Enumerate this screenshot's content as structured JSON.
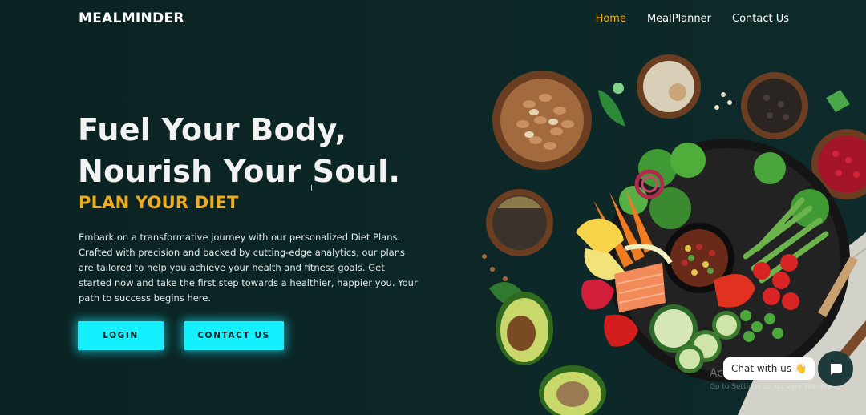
{
  "header": {
    "brand": "MEALMINDER",
    "nav": [
      {
        "label": "Home",
        "active": true
      },
      {
        "label": "MealPlanner",
        "active": false
      },
      {
        "label": "Contact Us",
        "active": false
      }
    ]
  },
  "hero": {
    "title_line1": "Fuel Your Body,",
    "title_line2": "Nourish Your Soul.",
    "subtitle": "PLAN YOUR DIET",
    "description": "Embark on a transformative journey with our personalized Diet Plans. Crafted with precision and backed by cutting-edge analytics, our plans are tailored to help you achieve your health and fitness goals. Get started now and take the first step towards a healthier, happier you. Your path to success begins here.",
    "login_label": "LOGIN",
    "contact_label": "CONTACT US"
  },
  "chat": {
    "label": "Chat with us",
    "emoji": "👋"
  },
  "overlay": {
    "watermark": "Activate Windows",
    "watermark_sub": "Go to Settings to activate Windows."
  },
  "colors": {
    "background": "#0c2424",
    "accent": "#f0ab1b",
    "button": "#14f0ff"
  },
  "icons": {
    "chat_button": "chat-bubble-icon",
    "food_image": "food-bowl-illustration"
  }
}
